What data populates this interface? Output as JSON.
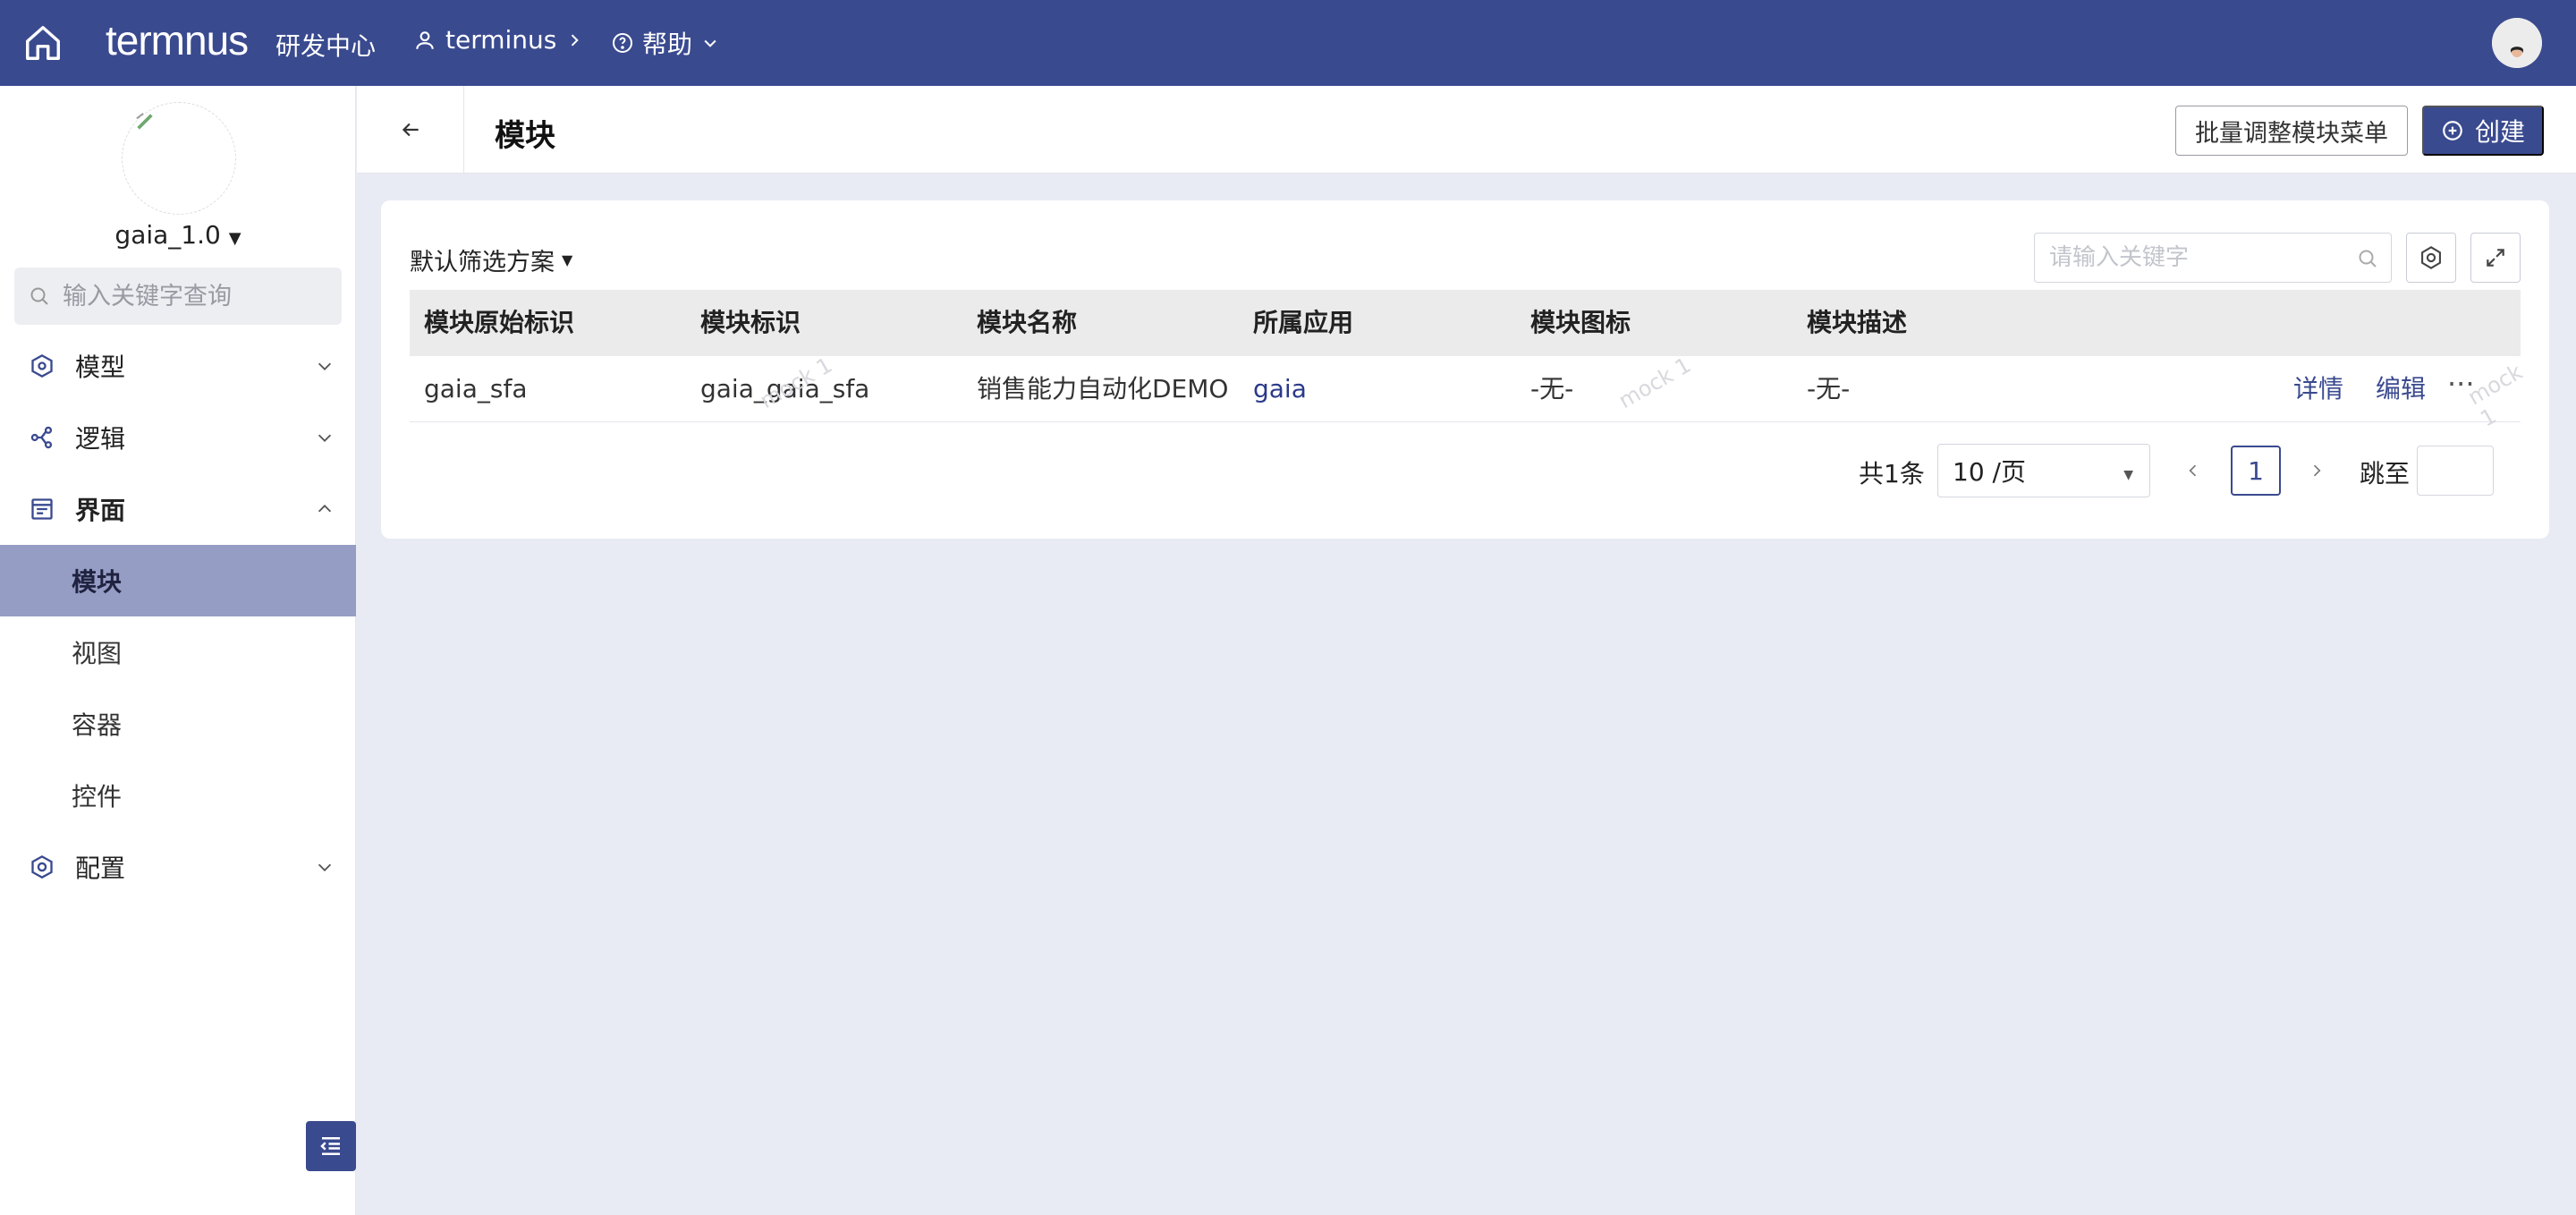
{
  "topbar": {
    "logo": "termnus",
    "center_title": "研发中心",
    "user_label": "terminus",
    "help_label": "帮助"
  },
  "sidebar": {
    "version": "gaia_1.0",
    "search_placeholder": "输入关键字查询",
    "menu": [
      {
        "label": "模型",
        "icon": "model-icon",
        "expanded": false
      },
      {
        "label": "逻辑",
        "icon": "logic-icon",
        "expanded": false
      },
      {
        "label": "界面",
        "icon": "ui-icon",
        "expanded": true
      },
      {
        "label": "配置",
        "icon": "config-icon",
        "expanded": false
      }
    ],
    "submenu": [
      {
        "label": "模块",
        "active": true
      },
      {
        "label": "视图",
        "active": false
      },
      {
        "label": "容器",
        "active": false
      },
      {
        "label": "控件",
        "active": false
      }
    ]
  },
  "header": {
    "title": "模块",
    "batch_label": "批量调整模块菜单",
    "create_label": "创建"
  },
  "toolbar": {
    "filter_scheme": "默认筛选方案",
    "search_placeholder": "请输入关键字"
  },
  "table": {
    "columns": [
      "模块原始标识",
      "模块标识",
      "模块名称",
      "所属应用",
      "模块图标",
      "模块描述"
    ],
    "rows": [
      {
        "original_key": "gaia_sfa",
        "key": "gaia_gaia_sfa",
        "name": "销售能力自动化DEMO",
        "app": "gaia",
        "icon": "-无-",
        "desc": "-无-",
        "actions": [
          "详情",
          "编辑"
        ]
      }
    ],
    "watermark": "mock 1"
  },
  "pagination": {
    "total": "共1条",
    "page_size": "10 /页",
    "current_page": "1",
    "jump_label": "跳至"
  },
  "colors": {
    "primary": "#3a4a8f",
    "active_menu": "#969dc4",
    "page_bg": "#e8ebf3"
  }
}
